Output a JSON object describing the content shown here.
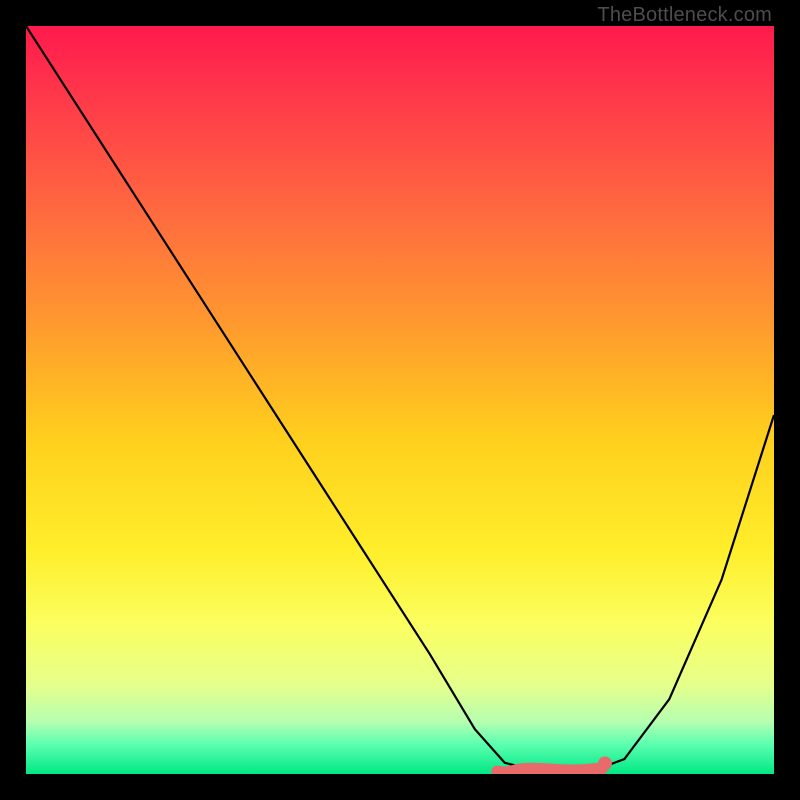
{
  "watermark": "TheBottleneck.com",
  "colors": {
    "background": "#000000",
    "curve_stroke": "#000000",
    "flat_segment": "#e86a6a",
    "gradient_top": "#ff1a4d",
    "gradient_bottom": "#00e884"
  },
  "chart_data": {
    "type": "line",
    "title": "",
    "xlabel": "",
    "ylabel": "",
    "xlim": [
      0,
      100
    ],
    "ylim": [
      0,
      100
    ],
    "grid": false,
    "legend": false,
    "annotations": [
      "TheBottleneck.com"
    ],
    "series": [
      {
        "name": "bottleneck-curve",
        "x": [
          0,
          9,
          18,
          27,
          36,
          45,
          54,
          60,
          64,
          68,
          72,
          76,
          80,
          86,
          93,
          100
        ],
        "y": [
          100,
          86,
          72,
          58,
          44,
          30,
          16,
          6,
          1.5,
          0.5,
          0.5,
          0.5,
          2,
          10,
          26,
          48
        ]
      }
    ],
    "flat_segment": {
      "description": "pink highlighted minimum region at bottom of V",
      "x_start": 63,
      "x_end": 77,
      "y": 0.6
    }
  }
}
